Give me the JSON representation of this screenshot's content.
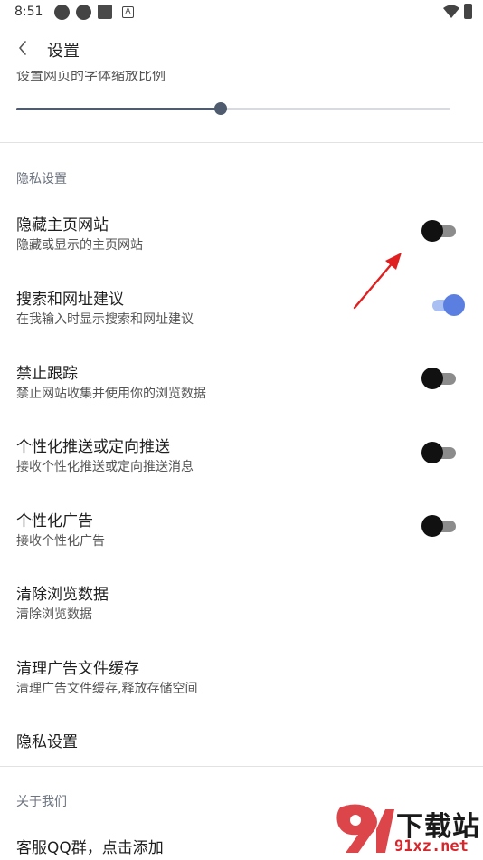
{
  "status_bar": {
    "time": "8:51",
    "icons": [
      "camera-icon",
      "camera-icon",
      "square-icon",
      "a-icon",
      "wifi-icon",
      "battery-icon"
    ]
  },
  "app_bar": {
    "title": "设置",
    "back_icon": "chevron-left-icon"
  },
  "clipped_text": "设置网页的字体缩放比例",
  "slider": {
    "value_fraction": 0.47,
    "color": "#4f5b6e"
  },
  "privacy_section": {
    "header": "隐私设置"
  },
  "settings": [
    {
      "title": "隐藏主页网站",
      "subtitle": "隐藏或显示的主页网站",
      "toggle": false
    },
    {
      "title": "搜索和网址建议",
      "subtitle": "在我输入时显示搜索和网址建议",
      "toggle": true
    },
    {
      "title": "禁止跟踪",
      "subtitle": "禁止网站收集并使用你的浏览数据",
      "toggle": false
    },
    {
      "title": "个性化推送或定向推送",
      "subtitle": "接收个性化推送或定向推送消息",
      "toggle": false
    },
    {
      "title": "个性化广告",
      "subtitle": "接收个性化广告",
      "toggle": false
    },
    {
      "title": "清除浏览数据",
      "subtitle": "清除浏览数据"
    },
    {
      "title": "清理广告文件缓存",
      "subtitle": "清理广告文件缓存,释放存储空间"
    },
    {
      "title": "隐私设置"
    }
  ],
  "about_section": {
    "header": "关于我们"
  },
  "qq_row": {
    "title": "客服QQ群，点击添加"
  },
  "watermark": {
    "text": "下载站",
    "url": "91xz.net"
  },
  "colors": {
    "accent": "#5b7fe0",
    "arrow": "#e02020",
    "watermark_red": "#d6262c"
  }
}
